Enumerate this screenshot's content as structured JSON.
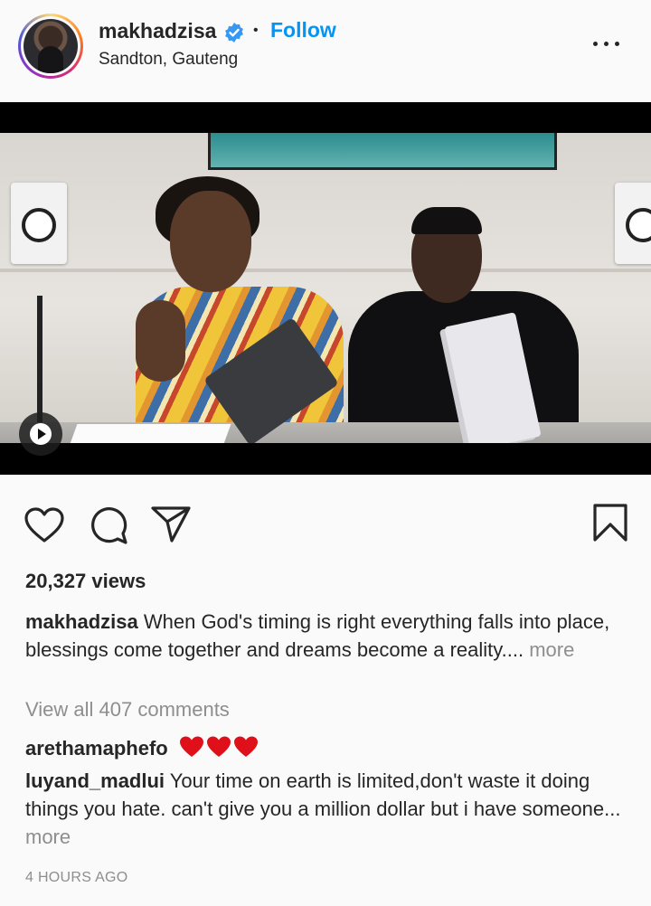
{
  "post": {
    "username": "makhadzisa",
    "follow_label": "Follow",
    "location": "Sandton, Gauteng"
  },
  "stats": {
    "views": "20,327 views"
  },
  "caption": {
    "username": "makhadzisa",
    "text": "When God's timing is right everything falls into place, blessings come together and dreams become a reality....",
    "more": "more"
  },
  "comments": {
    "view_all": "View all 407 comments",
    "items": [
      {
        "username": "arethamaphefo",
        "text": "❤❤❤"
      },
      {
        "username": "luyand_madlui",
        "text": "Your time on earth is limited,don't waste it doing things you hate. can't give you a million dollar but i have someone...",
        "more": "more"
      }
    ]
  },
  "timestamp": "4 HOURS AGO",
  "colors": {
    "accent": "#0095f6",
    "muted": "#8e8e8e",
    "text": "#262626",
    "heart": "#e0101b"
  },
  "icons": [
    "verified-icon",
    "more-options-icon",
    "play-icon",
    "like-icon",
    "comment-icon",
    "share-icon",
    "save-icon"
  ]
}
